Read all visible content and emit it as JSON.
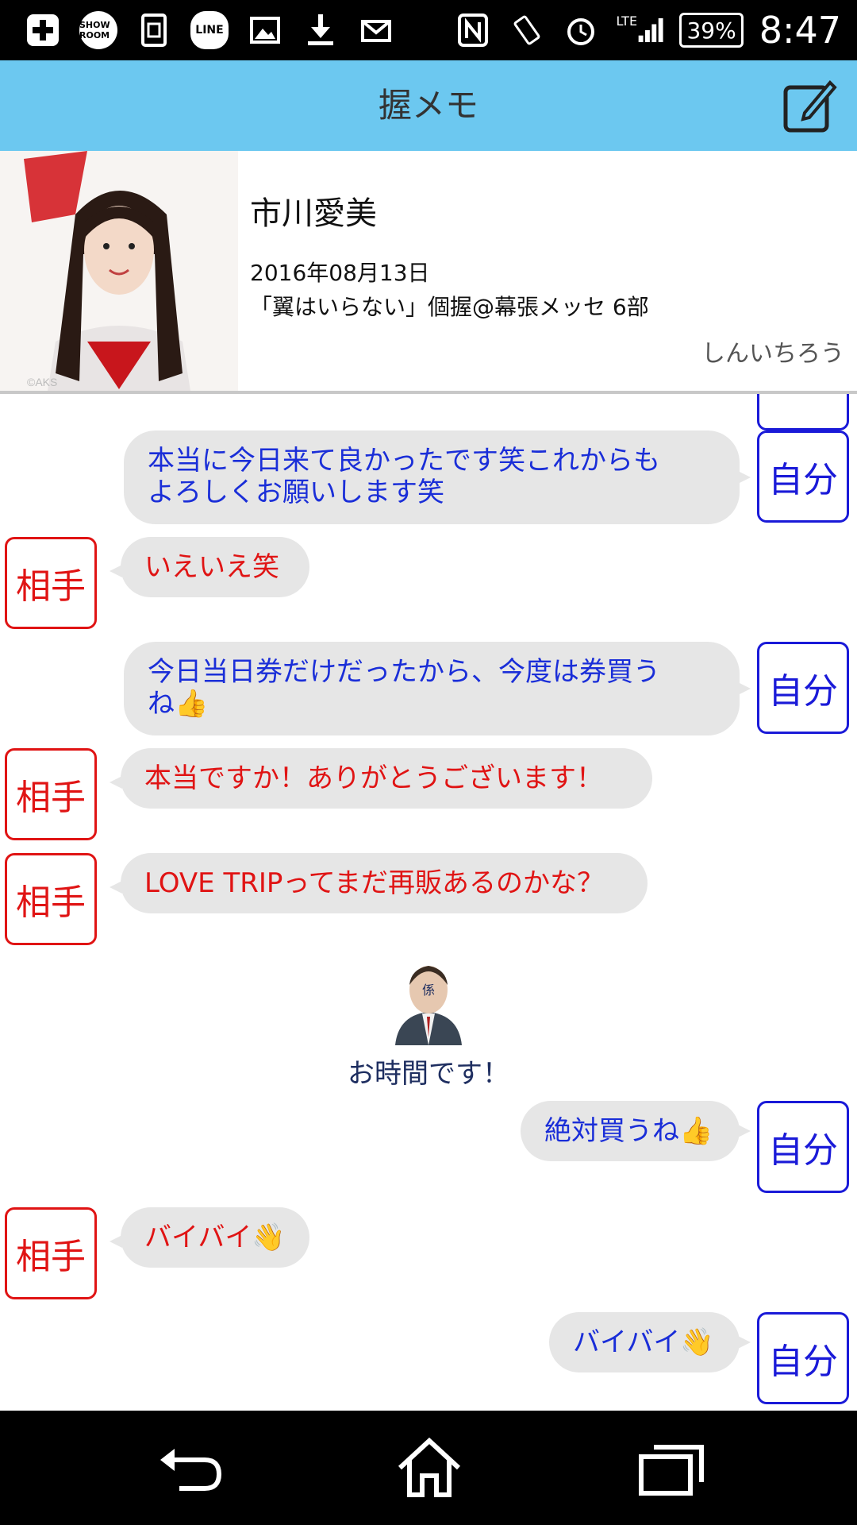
{
  "status_bar": {
    "icons": [
      "plus-box-icon",
      "showroom-icon",
      "sim-icon",
      "line-icon",
      "image-icon",
      "download-icon",
      "mail-icon",
      "nfc-icon",
      "rotate-icon",
      "alarm-icon"
    ],
    "showroom_label": "SHOW ROOM",
    "line_label": "LINE",
    "network": "LTE",
    "battery": "39%",
    "time": "8:47"
  },
  "app_bar": {
    "title": "握メモ",
    "compose_icon": "edit-icon"
  },
  "profile": {
    "name": "市川愛美",
    "date": "2016年08月13日",
    "event": "「翼はいらない」個握@幕張メッセ 6部",
    "user": "しんいちろう",
    "photo_watermark": "©AKS"
  },
  "labels": {
    "self": "自分",
    "other": "相手"
  },
  "messages": [
    {
      "from": "self",
      "lines": [
        "本当に今日来て良かったです笑これからも",
        "よろしくお願いします笑"
      ]
    },
    {
      "from": "other",
      "lines": [
        "いえいえ笑"
      ]
    },
    {
      "from": "self",
      "lines": [
        "今日当日券だけだったから、今度は券買う",
        "ね👍"
      ]
    },
    {
      "from": "other",
      "lines": [
        "本当ですか！ありがとうございます！"
      ]
    },
    {
      "from": "other",
      "lines": [
        "LOVE TRIPってまだ再販あるのかな？"
      ]
    },
    {
      "from": "staff",
      "text": "お時間です！",
      "badge": "係"
    },
    {
      "from": "self",
      "lines": [
        "絶対買うね👍"
      ]
    },
    {
      "from": "other",
      "lines": [
        "バイバイ👋"
      ]
    },
    {
      "from": "self",
      "lines": [
        "バイバイ👋"
      ]
    }
  ],
  "nav": {
    "back_icon": "back-icon",
    "home_icon": "home-icon",
    "recents_icon": "recents-icon"
  },
  "colors": {
    "app_bar": "#6cc8f0",
    "self": "#1a2ed8",
    "other": "#e01414",
    "bubble": "#e6e6e6"
  }
}
